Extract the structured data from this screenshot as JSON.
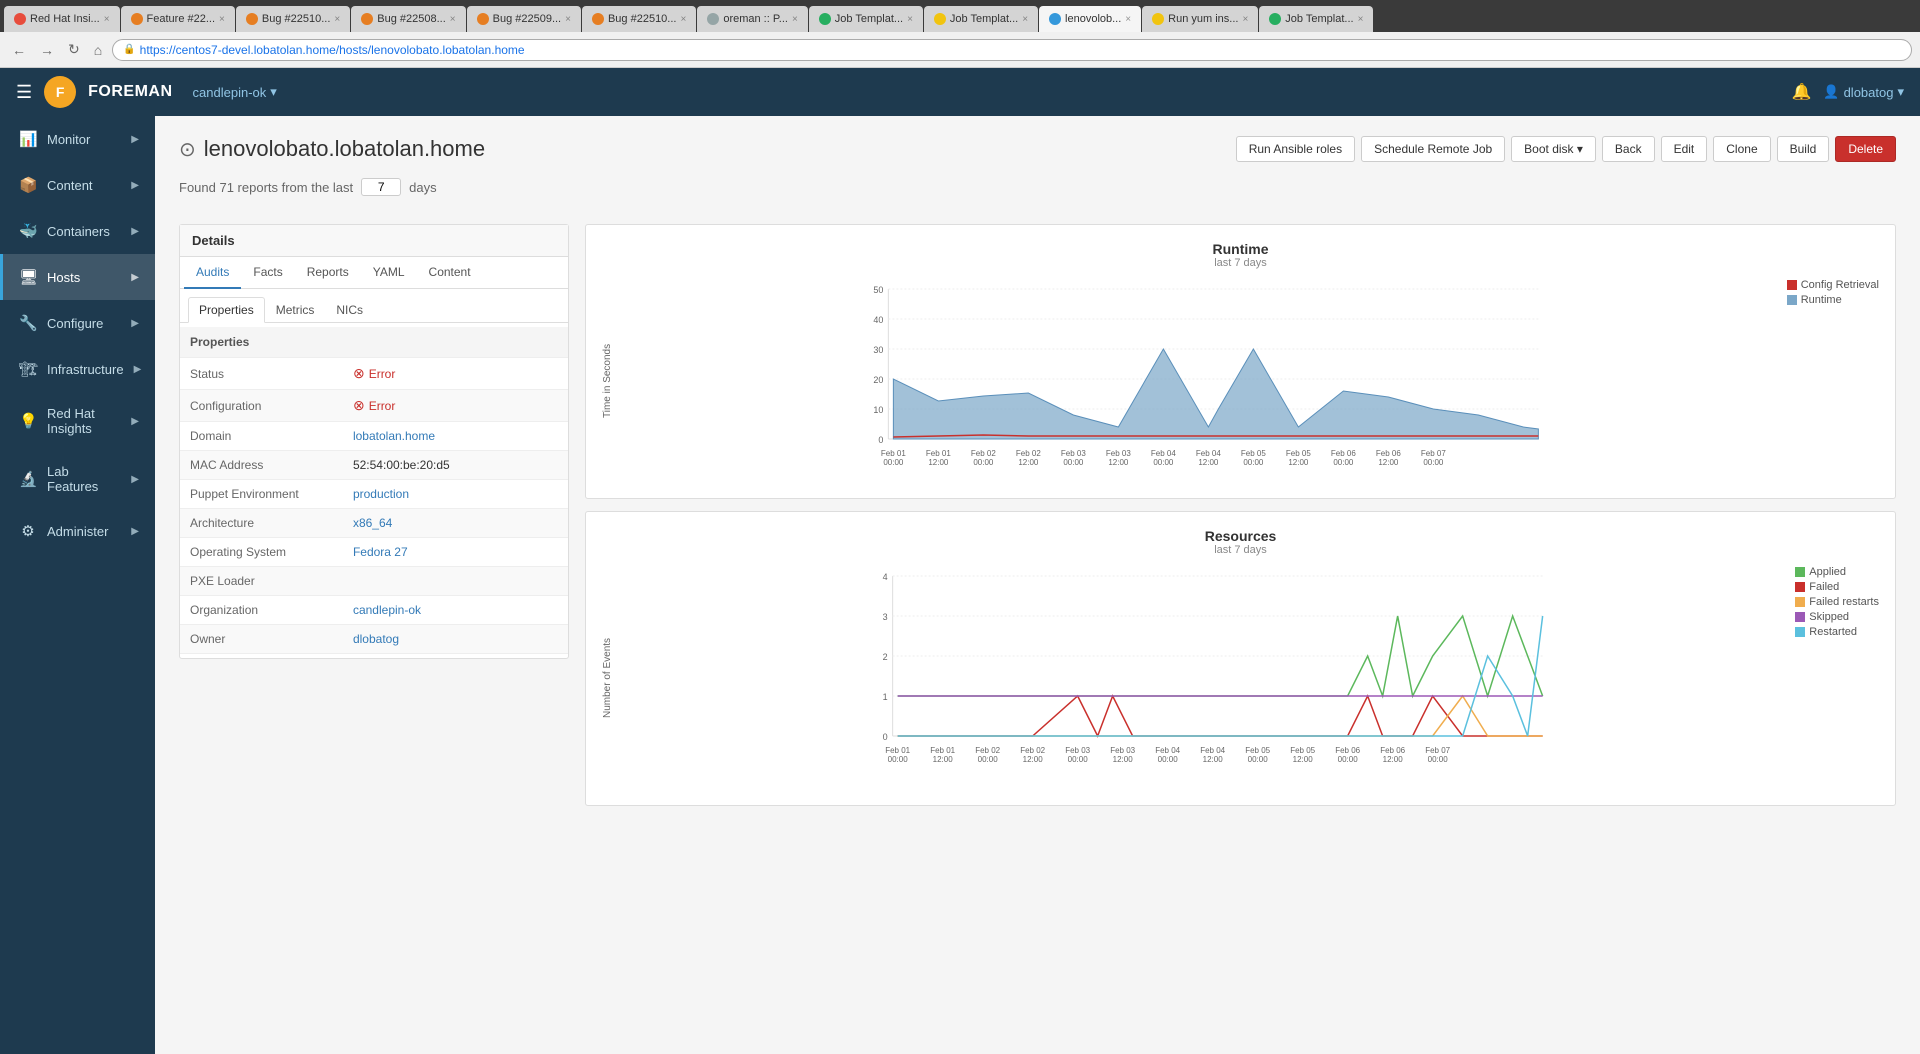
{
  "browser": {
    "url": "https://centos7-devel.lobatolan.home/hosts/lenovolobato.lobatolan.home",
    "tabs": [
      {
        "label": "Red Hat Insi...",
        "color": "#e74c3c",
        "active": false
      },
      {
        "label": "Feature #22...",
        "color": "#e67e22",
        "active": false
      },
      {
        "label": "Bug #22510...",
        "color": "#e67e22",
        "active": false
      },
      {
        "label": "Bug #22508...",
        "color": "#e67e22",
        "active": false
      },
      {
        "label": "Bug #22509...",
        "color": "#e67e22",
        "active": false
      },
      {
        "label": "Bug #22510...",
        "color": "#e67e22",
        "active": false
      },
      {
        "label": "oreman :: P...",
        "color": "#95a5a6",
        "active": false
      },
      {
        "label": "Job Templat...",
        "color": "#27ae60",
        "active": false
      },
      {
        "label": "Job Templat...",
        "color": "#f1c40f",
        "active": false
      },
      {
        "label": "lenovolob...",
        "color": "#3498db",
        "active": true
      },
      {
        "label": "Run yum ins...",
        "color": "#f1c40f",
        "active": false
      },
      {
        "label": "Job Templat...",
        "color": "#27ae60",
        "active": false
      }
    ]
  },
  "topnav": {
    "logo": "F",
    "app_name": "FOREMAN",
    "org": "candlepin-ok",
    "user": "dlobatog"
  },
  "sidebar": {
    "items": [
      {
        "label": "Monitor",
        "icon": "📊",
        "active": false
      },
      {
        "label": "Content",
        "icon": "📦",
        "active": false
      },
      {
        "label": "Containers",
        "icon": "🐳",
        "active": false
      },
      {
        "label": "Hosts",
        "icon": "🖥",
        "active": true
      },
      {
        "label": "Configure",
        "icon": "🔧",
        "active": false
      },
      {
        "label": "Infrastructure",
        "icon": "🏗",
        "active": false
      },
      {
        "label": "Red Hat Insights",
        "icon": "💡",
        "active": false
      },
      {
        "label": "Lab Features",
        "icon": "🔬",
        "active": false
      },
      {
        "label": "Administer",
        "icon": "⚙",
        "active": false
      }
    ]
  },
  "page": {
    "host_icon": "⊙",
    "title": "lenovolobato.lobatolan.home",
    "reports_text": "Found 71 reports from the last",
    "days_value": "7",
    "days_label": "days"
  },
  "actions": {
    "run_ansible": "Run Ansible roles",
    "schedule_remote": "Schedule Remote Job",
    "boot_disk": "Boot disk",
    "back": "Back",
    "edit": "Edit",
    "clone": "Clone",
    "build": "Build",
    "delete": "Delete"
  },
  "details": {
    "header": "Details",
    "tabs": [
      "Audits",
      "Facts",
      "Reports",
      "YAML",
      "Content"
    ],
    "active_tab": "Audits",
    "sub_tabs": [
      "Properties",
      "Metrics",
      "NICs"
    ],
    "active_sub_tab": "Properties",
    "properties_header": "Properties",
    "rows": [
      {
        "label": "Status",
        "value": "Error",
        "type": "error"
      },
      {
        "label": "Configuration",
        "value": "Error",
        "type": "error"
      },
      {
        "label": "Domain",
        "value": "lobatolan.home",
        "type": "link"
      },
      {
        "label": "MAC Address",
        "value": "52:54:00:be:20:d5",
        "type": "text"
      },
      {
        "label": "Puppet Environment",
        "value": "production",
        "type": "link"
      },
      {
        "label": "Architecture",
        "value": "x86_64",
        "type": "link"
      },
      {
        "label": "Operating System",
        "value": "Fedora 27",
        "type": "link"
      },
      {
        "label": "PXE Loader",
        "value": "",
        "type": "text"
      },
      {
        "label": "Organization",
        "value": "candlepin-ok",
        "type": "link"
      },
      {
        "label": "Owner",
        "value": "dlobatog",
        "type": "link"
      }
    ]
  },
  "runtime_chart": {
    "title": "Runtime",
    "subtitle": "last 7 days",
    "y_label": "Time in Seconds",
    "legend": [
      {
        "label": "Config Retrieval",
        "color": "#c9302c"
      },
      {
        "label": "Runtime",
        "color": "#7ba7c8"
      }
    ],
    "x_labels": [
      "Feb 01\n00:00",
      "Feb 01\n12:00",
      "Feb 02\n00:00",
      "Feb 02\n12:00",
      "Feb 03\n00:00",
      "Feb 03\n12:00",
      "Feb 04\n00:00",
      "Feb 04\n12:00",
      "Feb 05\n00:00",
      "Feb 05\n12:00",
      "Feb 06\n00:00",
      "Feb 06\n12:00",
      "Feb 07\n00:00"
    ],
    "y_max": 50,
    "y_ticks": [
      0,
      10,
      20,
      30,
      40,
      50
    ]
  },
  "resources_chart": {
    "title": "Resources",
    "subtitle": "last 7 days",
    "y_label": "Number of Events",
    "legend": [
      {
        "label": "Applied",
        "color": "#5cb85c"
      },
      {
        "label": "Failed",
        "color": "#c9302c"
      },
      {
        "label": "Failed restarts",
        "color": "#f0ad4e"
      },
      {
        "label": "Skipped",
        "color": "#9b59b6"
      },
      {
        "label": "Restarted",
        "color": "#5bc0de"
      }
    ],
    "x_labels": [
      "Feb 01\n00:00",
      "Feb 01\n12:00",
      "Feb 02\n00:00",
      "Feb 02\n12:00",
      "Feb 03\n00:00",
      "Feb 03\n12:00",
      "Feb 04\n00:00",
      "Feb 04\n12:00",
      "Feb 05\n00:00",
      "Feb 05\n12:00",
      "Feb 06\n00:00",
      "Feb 06\n12:00",
      "Feb 07\n00:00"
    ],
    "y_max": 4,
    "y_ticks": [
      0,
      1,
      2,
      3,
      4
    ]
  }
}
